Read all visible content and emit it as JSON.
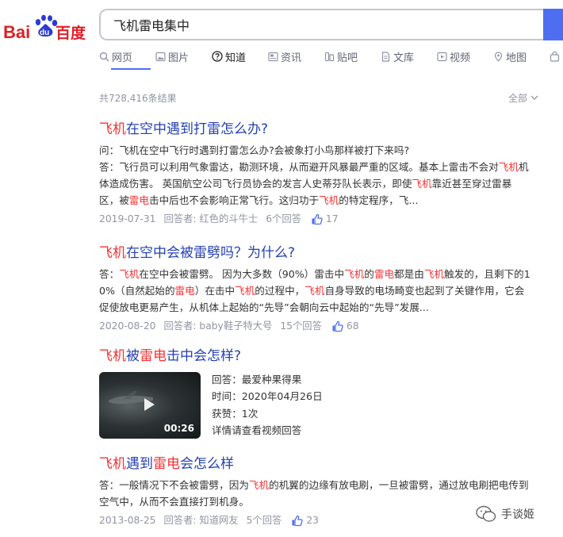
{
  "logo": {
    "text": "Bai百度",
    "left": "Bai",
    "paw": "du",
    "right": "百度"
  },
  "search": {
    "query": "飞机雷电集中"
  },
  "tabs": [
    {
      "label": "网页",
      "icon": "search-icon",
      "active": false
    },
    {
      "label": "图片",
      "icon": "image-icon",
      "active": false
    },
    {
      "label": "知道",
      "icon": "question-icon",
      "active": true
    },
    {
      "label": "资讯",
      "icon": "news-icon",
      "active": false
    },
    {
      "label": "贴吧",
      "icon": "tieba-icon",
      "active": false
    },
    {
      "label": "文库",
      "icon": "document-icon",
      "active": false
    },
    {
      "label": "视频",
      "icon": "video-icon",
      "active": false
    },
    {
      "label": "地图",
      "icon": "map-icon",
      "active": false
    }
  ],
  "result_count": "共728,416条结果",
  "filter": {
    "label": "全部"
  },
  "results": [
    {
      "title_hl": "飞机",
      "title_rest": "在空中遇到打雷怎么办?",
      "question": "问：飞机在空中飞行时遇到打雷怎么办?会被象打小鸟那样被打下来吗?",
      "answer_lines": [
        [
          {
            "t": "答：飞行员可以利用气象雷达，勘测环境，从而避开风暴最严重的区域。基本上雷击不会对"
          },
          {
            "t": "飞机",
            "h": true
          },
          {
            "t": "机"
          }
        ],
        [
          {
            "t": "体造成伤害。 英国航空公司飞行员协会的发言人史蒂芬队长表示，即使"
          },
          {
            "t": "飞机",
            "h": true
          },
          {
            "t": "靠近甚至穿过雷暴"
          }
        ],
        [
          {
            "t": "区，被"
          },
          {
            "t": "雷电",
            "h": true
          },
          {
            "t": "击中后也不会影响正常飞行。这归功于"
          },
          {
            "t": "飞机",
            "h": true
          },
          {
            "t": "的特定程序，飞..."
          }
        ]
      ],
      "date": "2019-07-31",
      "answerer": "回答者: 红色的斗牛士",
      "answers": "6个回答",
      "likes": "17"
    },
    {
      "title_hl": "飞机",
      "title_rest": "在空中会被雷劈吗？为什么?",
      "answer_lines": [
        [
          {
            "t": "答："
          },
          {
            "t": "飞机",
            "h": true
          },
          {
            "t": "在空中会被雷劈。 因为大多数（90%）雷击中"
          },
          {
            "t": "飞机",
            "h": true
          },
          {
            "t": "的"
          },
          {
            "t": "雷电",
            "h": true
          },
          {
            "t": "都是由"
          },
          {
            "t": "飞机",
            "h": true
          },
          {
            "t": "触发的，且剩下的1"
          }
        ],
        [
          {
            "t": "0%（自然起始的"
          },
          {
            "t": "雷电",
            "h": true
          },
          {
            "t": "）在击中"
          },
          {
            "t": "飞机",
            "h": true
          },
          {
            "t": "的过程中，"
          },
          {
            "t": "飞机",
            "h": true
          },
          {
            "t": "自身导致的电场畸变也起到了关键作用，它会"
          }
        ],
        [
          {
            "t": "促使放电更易产生，从机体上起始的“先导”会朝向云中起始的“先导”发展..."
          }
        ]
      ],
      "date": "2020-08-20",
      "answerer": "回答者: baby鞋子特大号",
      "answers": "15个回答",
      "likes": "68"
    },
    {
      "title_hl": "飞机",
      "title_mid": "被",
      "title_hl2": "雷电",
      "title_rest": "击中会怎样?",
      "video": {
        "duration": "00:26",
        "answerer": "回答：最爱种果得果",
        "time": "时间：2020年04月26日",
        "likes": "获赞：1次",
        "details": "详情请查看视频回答"
      }
    },
    {
      "title_hl": "飞机",
      "title_mid": "遇到",
      "title_hl2": "雷电",
      "title_rest": "会怎么样",
      "answer_lines": [
        [
          {
            "t": "答：一般情况下不会被雷劈，因为"
          },
          {
            "t": "飞机",
            "h": true
          },
          {
            "t": "的机翼的边缘有放电刷，一旦被雷劈，通过放电刷把电传到"
          }
        ],
        [
          {
            "t": "空气中，从而不会直接打到机身。"
          }
        ]
      ],
      "date": "2013-08-25",
      "answerer": "回答者: 知道网友",
      "answers": "5个回答",
      "likes": "23"
    }
  ],
  "watermark": "手谈姬",
  "colors": {
    "brand_blue": "#4e6ef2",
    "title_blue": "#2440b3",
    "highlight_red": "#f73131",
    "meta_gray": "#9195a3"
  }
}
